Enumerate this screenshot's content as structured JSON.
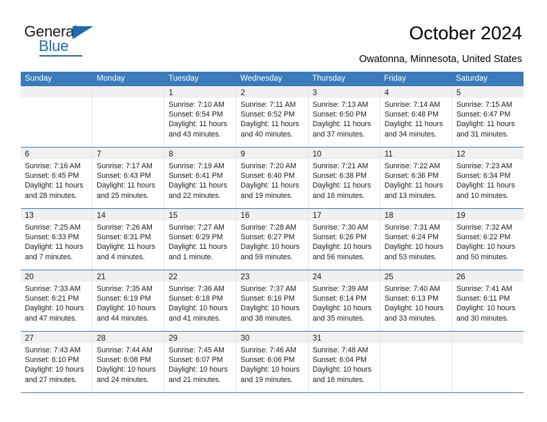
{
  "brand": {
    "name_top": "General",
    "name_bottom": "Blue",
    "accent_color": "#1f6cb0"
  },
  "header": {
    "title": "October 2024",
    "subtitle": "Owatonna, Minnesota, United States"
  },
  "calendar": {
    "header_bg": "#3b7bba",
    "daynum_band_bg": "#f0f0f0",
    "weekday_headers": [
      "Sunday",
      "Monday",
      "Tuesday",
      "Wednesday",
      "Thursday",
      "Friday",
      "Saturday"
    ],
    "weeks": [
      [
        {
          "day": "",
          "lines": []
        },
        {
          "day": "",
          "lines": []
        },
        {
          "day": "1",
          "lines": [
            "Sunrise: 7:10 AM",
            "Sunset: 6:54 PM",
            "Daylight: 11 hours",
            "and 43 minutes."
          ]
        },
        {
          "day": "2",
          "lines": [
            "Sunrise: 7:11 AM",
            "Sunset: 6:52 PM",
            "Daylight: 11 hours",
            "and 40 minutes."
          ]
        },
        {
          "day": "3",
          "lines": [
            "Sunrise: 7:13 AM",
            "Sunset: 6:50 PM",
            "Daylight: 11 hours",
            "and 37 minutes."
          ]
        },
        {
          "day": "4",
          "lines": [
            "Sunrise: 7:14 AM",
            "Sunset: 6:48 PM",
            "Daylight: 11 hours",
            "and 34 minutes."
          ]
        },
        {
          "day": "5",
          "lines": [
            "Sunrise: 7:15 AM",
            "Sunset: 6:47 PM",
            "Daylight: 11 hours",
            "and 31 minutes."
          ]
        }
      ],
      [
        {
          "day": "6",
          "lines": [
            "Sunrise: 7:16 AM",
            "Sunset: 6:45 PM",
            "Daylight: 11 hours",
            "and 28 minutes."
          ]
        },
        {
          "day": "7",
          "lines": [
            "Sunrise: 7:17 AM",
            "Sunset: 6:43 PM",
            "Daylight: 11 hours",
            "and 25 minutes."
          ]
        },
        {
          "day": "8",
          "lines": [
            "Sunrise: 7:19 AM",
            "Sunset: 6:41 PM",
            "Daylight: 11 hours",
            "and 22 minutes."
          ]
        },
        {
          "day": "9",
          "lines": [
            "Sunrise: 7:20 AM",
            "Sunset: 6:40 PM",
            "Daylight: 11 hours",
            "and 19 minutes."
          ]
        },
        {
          "day": "10",
          "lines": [
            "Sunrise: 7:21 AM",
            "Sunset: 6:38 PM",
            "Daylight: 11 hours",
            "and 16 minutes."
          ]
        },
        {
          "day": "11",
          "lines": [
            "Sunrise: 7:22 AM",
            "Sunset: 6:36 PM",
            "Daylight: 11 hours",
            "and 13 minutes."
          ]
        },
        {
          "day": "12",
          "lines": [
            "Sunrise: 7:23 AM",
            "Sunset: 6:34 PM",
            "Daylight: 11 hours",
            "and 10 minutes."
          ]
        }
      ],
      [
        {
          "day": "13",
          "lines": [
            "Sunrise: 7:25 AM",
            "Sunset: 6:33 PM",
            "Daylight: 11 hours",
            "and 7 minutes."
          ]
        },
        {
          "day": "14",
          "lines": [
            "Sunrise: 7:26 AM",
            "Sunset: 6:31 PM",
            "Daylight: 11 hours",
            "and 4 minutes."
          ]
        },
        {
          "day": "15",
          "lines": [
            "Sunrise: 7:27 AM",
            "Sunset: 6:29 PM",
            "Daylight: 11 hours",
            "and 1 minute."
          ]
        },
        {
          "day": "16",
          "lines": [
            "Sunrise: 7:28 AM",
            "Sunset: 6:27 PM",
            "Daylight: 10 hours",
            "and 59 minutes."
          ]
        },
        {
          "day": "17",
          "lines": [
            "Sunrise: 7:30 AM",
            "Sunset: 6:26 PM",
            "Daylight: 10 hours",
            "and 56 minutes."
          ]
        },
        {
          "day": "18",
          "lines": [
            "Sunrise: 7:31 AM",
            "Sunset: 6:24 PM",
            "Daylight: 10 hours",
            "and 53 minutes."
          ]
        },
        {
          "day": "19",
          "lines": [
            "Sunrise: 7:32 AM",
            "Sunset: 6:22 PM",
            "Daylight: 10 hours",
            "and 50 minutes."
          ]
        }
      ],
      [
        {
          "day": "20",
          "lines": [
            "Sunrise: 7:33 AM",
            "Sunset: 6:21 PM",
            "Daylight: 10 hours",
            "and 47 minutes."
          ]
        },
        {
          "day": "21",
          "lines": [
            "Sunrise: 7:35 AM",
            "Sunset: 6:19 PM",
            "Daylight: 10 hours",
            "and 44 minutes."
          ]
        },
        {
          "day": "22",
          "lines": [
            "Sunrise: 7:36 AM",
            "Sunset: 6:18 PM",
            "Daylight: 10 hours",
            "and 41 minutes."
          ]
        },
        {
          "day": "23",
          "lines": [
            "Sunrise: 7:37 AM",
            "Sunset: 6:16 PM",
            "Daylight: 10 hours",
            "and 38 minutes."
          ]
        },
        {
          "day": "24",
          "lines": [
            "Sunrise: 7:39 AM",
            "Sunset: 6:14 PM",
            "Daylight: 10 hours",
            "and 35 minutes."
          ]
        },
        {
          "day": "25",
          "lines": [
            "Sunrise: 7:40 AM",
            "Sunset: 6:13 PM",
            "Daylight: 10 hours",
            "and 33 minutes."
          ]
        },
        {
          "day": "26",
          "lines": [
            "Sunrise: 7:41 AM",
            "Sunset: 6:11 PM",
            "Daylight: 10 hours",
            "and 30 minutes."
          ]
        }
      ],
      [
        {
          "day": "27",
          "lines": [
            "Sunrise: 7:43 AM",
            "Sunset: 6:10 PM",
            "Daylight: 10 hours",
            "and 27 minutes."
          ]
        },
        {
          "day": "28",
          "lines": [
            "Sunrise: 7:44 AM",
            "Sunset: 6:08 PM",
            "Daylight: 10 hours",
            "and 24 minutes."
          ]
        },
        {
          "day": "29",
          "lines": [
            "Sunrise: 7:45 AM",
            "Sunset: 6:07 PM",
            "Daylight: 10 hours",
            "and 21 minutes."
          ]
        },
        {
          "day": "30",
          "lines": [
            "Sunrise: 7:46 AM",
            "Sunset: 6:06 PM",
            "Daylight: 10 hours",
            "and 19 minutes."
          ]
        },
        {
          "day": "31",
          "lines": [
            "Sunrise: 7:48 AM",
            "Sunset: 6:04 PM",
            "Daylight: 10 hours",
            "and 16 minutes."
          ]
        },
        {
          "day": "",
          "lines": []
        },
        {
          "day": "",
          "lines": []
        }
      ]
    ]
  }
}
